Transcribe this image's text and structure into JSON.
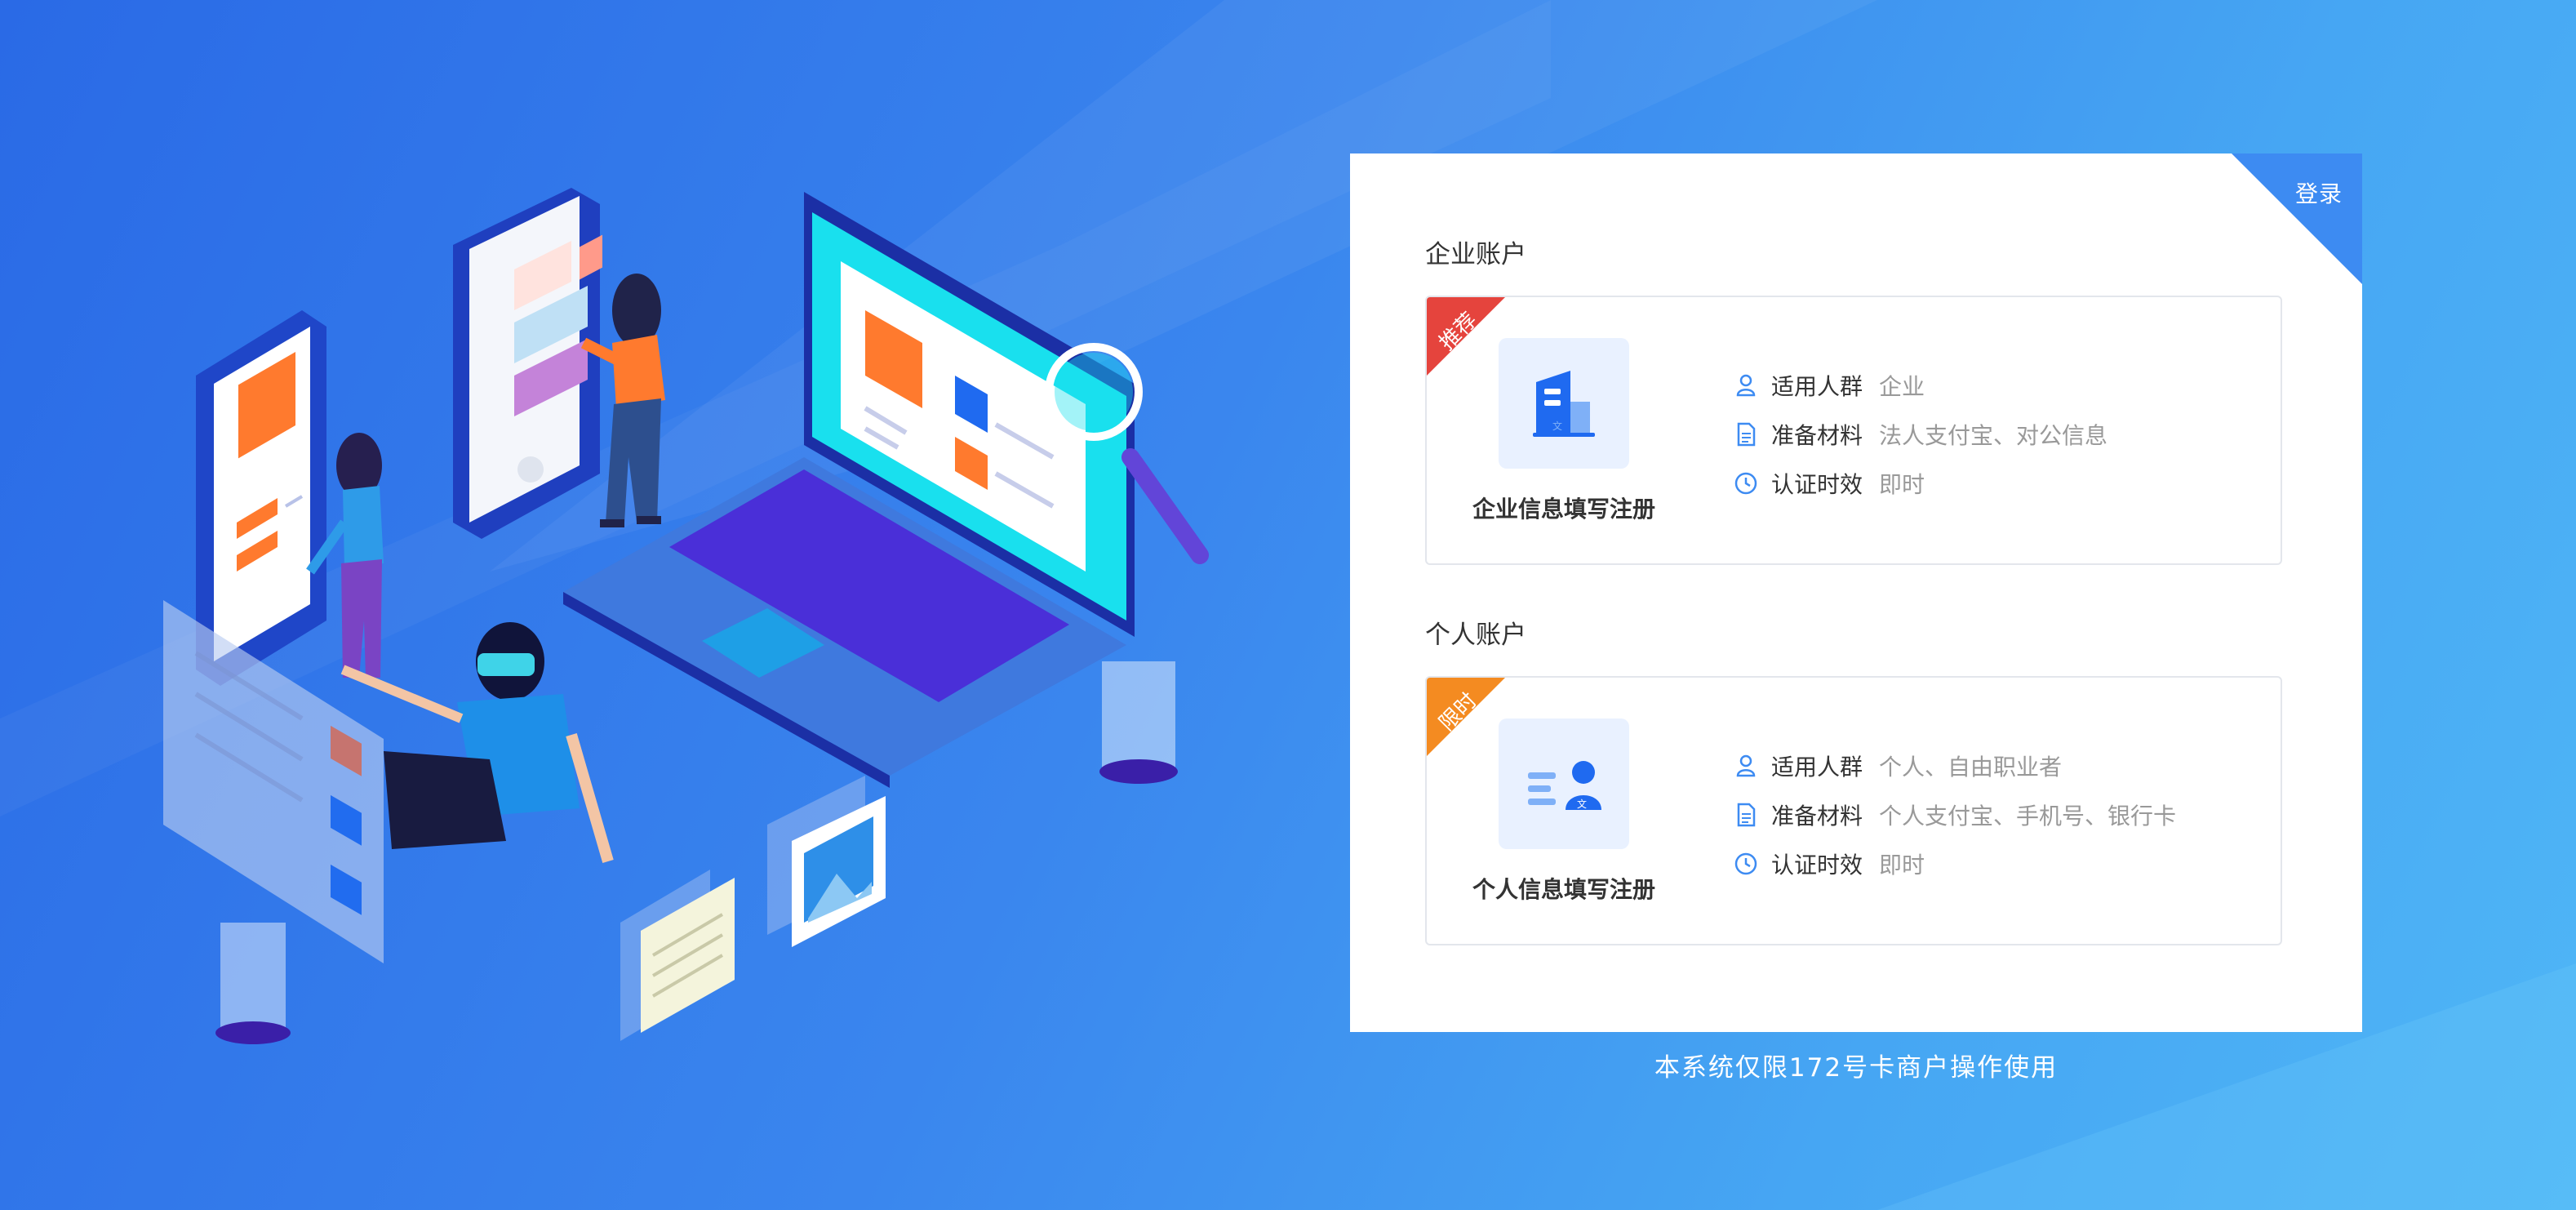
{
  "colors": {
    "accent": "#3d8bf2",
    "recommend_ribbon": "#e5443d",
    "limited_ribbon": "#f48b21"
  },
  "panel": {
    "login_label": "登录",
    "enterprise": {
      "section_title": "企业账户",
      "ribbon": "推荐",
      "icon": "building-icon",
      "name": "企业信息填写注册",
      "rows": [
        {
          "icon": "user-icon",
          "label": "适用人群",
          "value": "企业"
        },
        {
          "icon": "document-icon",
          "label": "准备材料",
          "value": "法人支付宝、对公信息"
        },
        {
          "icon": "clock-icon",
          "label": "认证时效",
          "value": "即时"
        }
      ]
    },
    "personal": {
      "section_title": "个人账户",
      "ribbon": "限时",
      "icon": "id-card-icon",
      "name": "个人信息填写注册",
      "rows": [
        {
          "icon": "user-icon",
          "label": "适用人群",
          "value": "个人、自由职业者"
        },
        {
          "icon": "document-icon",
          "label": "准备材料",
          "value": "个人支付宝、手机号、银行卡"
        },
        {
          "icon": "clock-icon",
          "label": "认证时效",
          "value": "即时"
        }
      ]
    }
  },
  "footer_note": "本系统仅限172号卡商户操作使用"
}
